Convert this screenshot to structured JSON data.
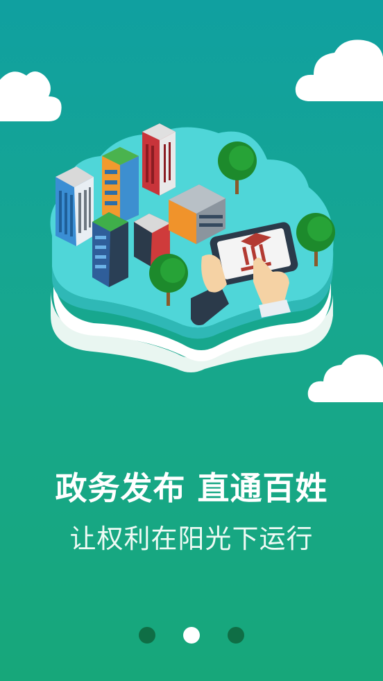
{
  "splash": {
    "headline": "政务发布 直通百姓",
    "subline": "让权利在阳光下运行"
  },
  "pager": {
    "pages": 3,
    "active_index": 1
  },
  "colors": {
    "dot_inactive": "#0f6e45",
    "dot_active": "#ffffff"
  }
}
